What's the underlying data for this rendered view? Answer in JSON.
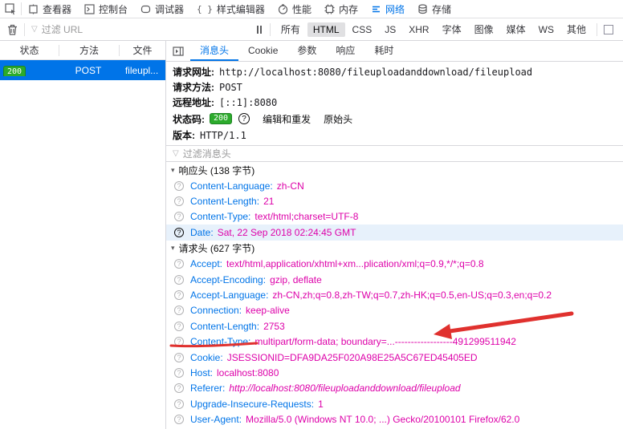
{
  "colors": {
    "accent_blue": "#0074e8",
    "header_value_magenta": "#dd00a9",
    "status_green": "#2cab2c",
    "annotation_red": "#e0312e",
    "selected_row_blue": "#0074e8"
  },
  "icons": {
    "element-picker-icon": "cursor-in-box",
    "filter-funnel-icon": "▽",
    "collapse-arrow-icon": "▾",
    "help-circle-icon": "?",
    "pause-icon": "❚❚"
  },
  "toolbar_tabs": {
    "items": [
      {
        "label": "查看器",
        "active": false
      },
      {
        "label": "控制台",
        "active": false
      },
      {
        "label": "调试器",
        "active": false
      },
      {
        "label": "样式编辑器",
        "active": false
      },
      {
        "label": "性能",
        "active": false
      },
      {
        "label": "内存",
        "active": false
      },
      {
        "label": "网络",
        "active": true
      },
      {
        "label": "存储",
        "active": false
      }
    ]
  },
  "network_toolbar": {
    "url_filter_placeholder": "过滤 URL",
    "filters": [
      {
        "label": "所有",
        "active": false
      },
      {
        "label": "HTML",
        "active": true
      },
      {
        "label": "CSS",
        "active": false
      },
      {
        "label": "JS",
        "active": false
      },
      {
        "label": "XHR",
        "active": false
      },
      {
        "label": "字体",
        "active": false
      },
      {
        "label": "图像",
        "active": false
      },
      {
        "label": "媒体",
        "active": false
      },
      {
        "label": "WS",
        "active": false
      },
      {
        "label": "其他",
        "active": false
      }
    ]
  },
  "request_list": {
    "columns": [
      "状态",
      "方法",
      "文件"
    ],
    "row": {
      "status": "200",
      "method": "POST",
      "file": "fileupl..."
    }
  },
  "details": {
    "tabs": [
      "消息头",
      "Cookie",
      "参数",
      "响应",
      "耗时"
    ],
    "active_tab": "消息头",
    "summary": {
      "url_label": "请求网址:",
      "url": "http://localhost:8080/fileuploadanddownload/fileupload",
      "method_label": "请求方法:",
      "method": "POST",
      "remote_label": "远程地址:",
      "remote": "[::1]:8080",
      "status_label": "状态码:",
      "status_code": "200",
      "edit_resend_label": "编辑和重发",
      "raw_headers_label": "原始头",
      "version_label": "版本:",
      "version": "HTTP/1.1"
    },
    "header_filter_placeholder": "过滤消息头",
    "response_headers": {
      "title": "响应头 (138 字节)",
      "items": [
        {
          "name": "Content-Language:",
          "value": "zh-CN"
        },
        {
          "name": "Content-Length:",
          "value": "21"
        },
        {
          "name": "Content-Type:",
          "value": "text/html;charset=UTF-8"
        },
        {
          "name": "Date:",
          "value": "Sat, 22 Sep 2018 02:24:45 GMT",
          "highlighted": true,
          "dark_icon": true
        }
      ]
    },
    "request_headers": {
      "title": "请求头 (627 字节)",
      "items": [
        {
          "name": "Accept:",
          "value": "text/html,application/xhtml+xm...plication/xml;q=0.9,*/*;q=0.8"
        },
        {
          "name": "Accept-Encoding:",
          "value": "gzip, deflate"
        },
        {
          "name": "Accept-Language:",
          "value": "zh-CN,zh;q=0.8,zh-TW;q=0.7,zh-HK;q=0.5,en-US;q=0.3,en;q=0.2"
        },
        {
          "name": "Connection:",
          "value": "keep-alive"
        },
        {
          "name": "Content-Length:",
          "value": "2753"
        },
        {
          "name": "Content-Type:",
          "value": "multipart/form-data; boundary=...------------------491299511942",
          "red_underline": true
        },
        {
          "name": "Cookie:",
          "value": "JSESSIONID=DFA9DA25F020A98E25A5C67ED45405ED"
        },
        {
          "name": "Host:",
          "value": "localhost:8080"
        },
        {
          "name": "Referer:",
          "value": "http://localhost:8080/fileuploadanddownload/fileupload",
          "italic": true
        },
        {
          "name": "Upgrade-Insecure-Requests:",
          "value": "1"
        },
        {
          "name": "User-Agent:",
          "value": "Mozilla/5.0 (Windows NT 10.0; ...) Gecko/20100101 Firefox/62.0"
        }
      ]
    }
  }
}
